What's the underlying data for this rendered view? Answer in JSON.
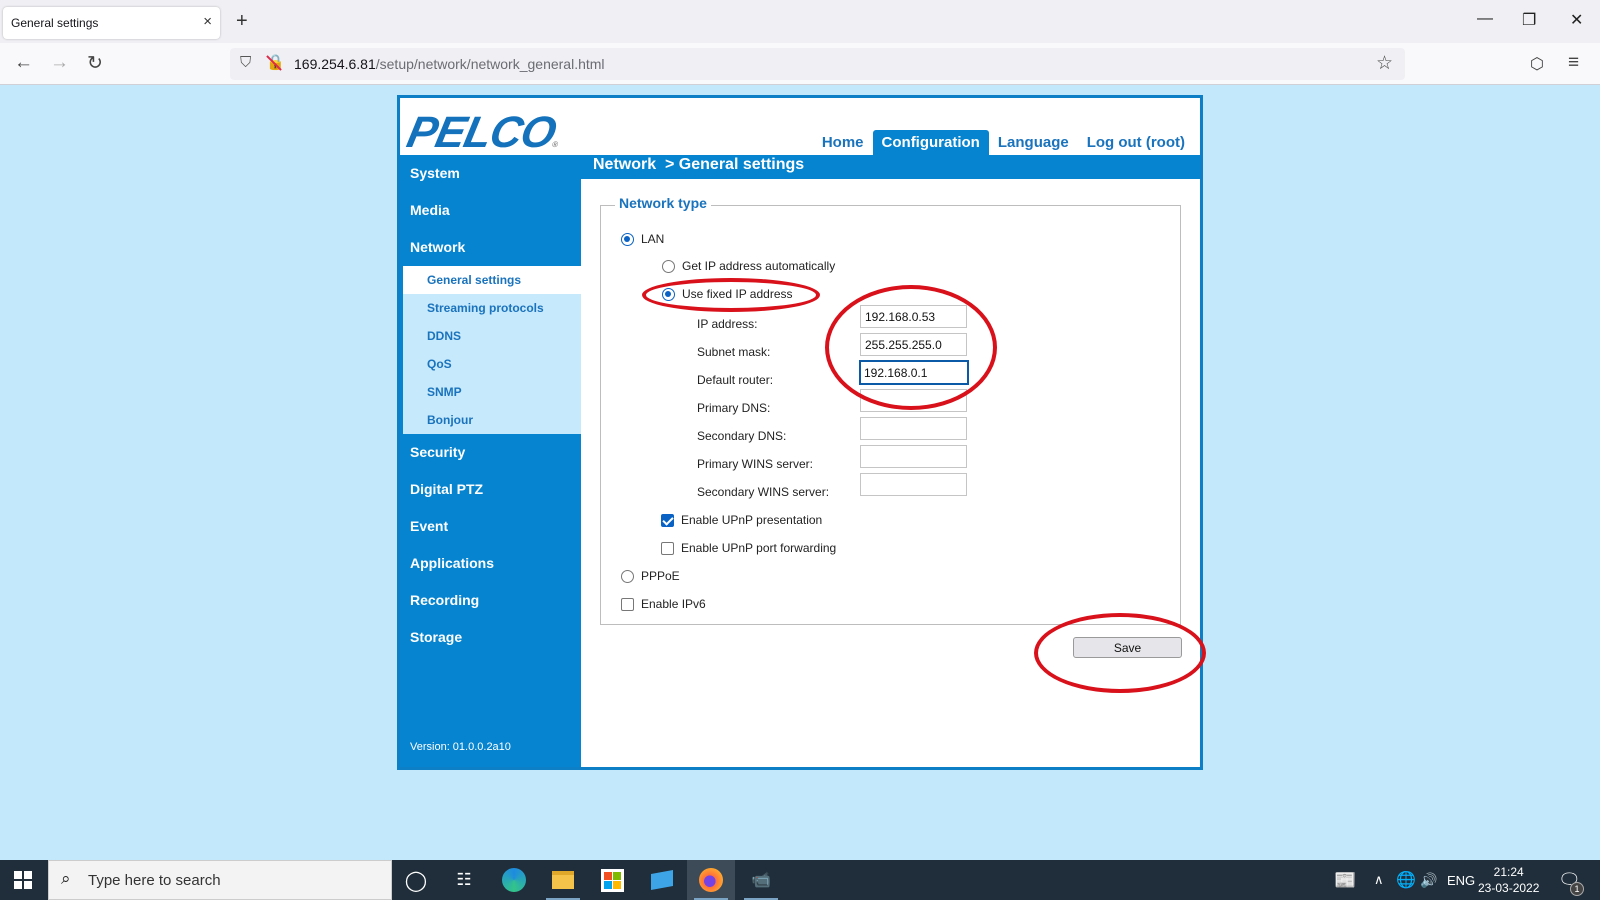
{
  "browser": {
    "tab_title": "General settings",
    "url_host": "169.254.6.81",
    "url_path": "/setup/network/network_general.html",
    "icons": {
      "tab_close": "×",
      "new_tab": "+",
      "minimize": "—",
      "restore": "❐",
      "close": "✕",
      "back": "←",
      "forward": "→",
      "reload": "↻",
      "shield": "⛉",
      "lock": "🔓",
      "star": "☆",
      "pocket": "⛉",
      "menu": "≡"
    }
  },
  "app": {
    "logo": "PELCO",
    "logo_mark": "®",
    "topnav": [
      {
        "label": "Home"
      },
      {
        "label": "Configuration",
        "active": true
      },
      {
        "label": "Language"
      },
      {
        "label": "Log out (root)"
      }
    ],
    "breadcrumb": "Network  > General settings",
    "sidebar": {
      "items_top": [
        "System",
        "Media",
        "Network"
      ],
      "sub_items": [
        "General settings",
        "Streaming protocols",
        "DDNS",
        "QoS",
        "SNMP",
        "Bonjour"
      ],
      "active_sub": "General settings",
      "items_bottom": [
        "Security",
        "Digital PTZ",
        "Event",
        "Applications",
        "Recording",
        "Storage"
      ],
      "version": "Version: 01.0.0.2a10"
    },
    "form": {
      "legend": "Network type",
      "lan_label": "LAN",
      "lan_selected": true,
      "auto_ip_label": "Get IP address automatically",
      "auto_ip_selected": false,
      "fixed_ip_label": "Use fixed IP address",
      "fixed_ip_selected": true,
      "fields": [
        {
          "label": "IP address:",
          "value": "192.168.0.53"
        },
        {
          "label": "Subnet mask:",
          "value": "255.255.255.0"
        },
        {
          "label": "Default router:",
          "value": "192.168.0.1",
          "focused": true
        },
        {
          "label": "Primary DNS:",
          "value": ""
        },
        {
          "label": "Secondary DNS:",
          "value": ""
        },
        {
          "label": "Primary WINS server:",
          "value": ""
        },
        {
          "label": "Secondary WINS server:",
          "value": ""
        }
      ],
      "upnp_presentation_label": "Enable UPnP presentation",
      "upnp_presentation_checked": true,
      "upnp_forwarding_label": "Enable UPnP port forwarding",
      "upnp_forwarding_checked": false,
      "pppoe_label": "PPPoE",
      "pppoe_selected": false,
      "ipv6_label": "Enable IPv6",
      "ipv6_checked": false,
      "save_label": "Save"
    },
    "annotation_color": "#d8111b"
  },
  "taskbar": {
    "search_placeholder": "Type here to search",
    "apps": [
      "cortana",
      "task-view",
      "edge",
      "file-explorer",
      "microsoft-store",
      "remote-desktop",
      "firefox",
      "camera-tool"
    ],
    "tray": {
      "language": "ENG",
      "time": "21:24",
      "date": "23-03-2022",
      "notification_count": "1"
    }
  }
}
